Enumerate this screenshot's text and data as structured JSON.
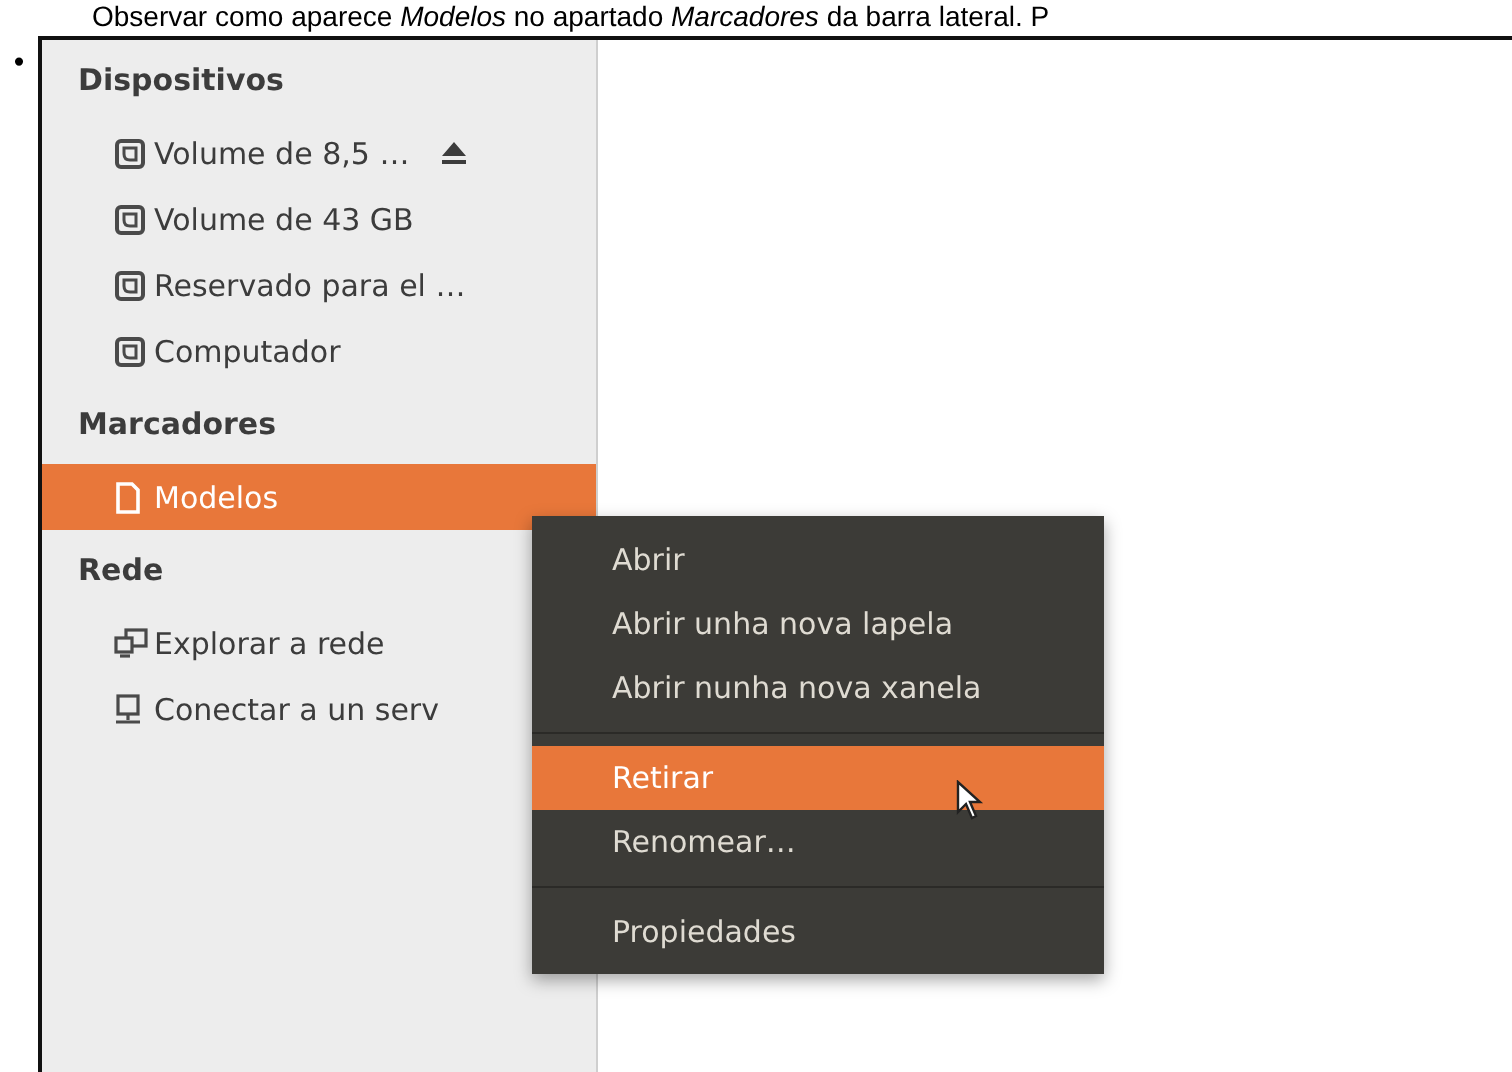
{
  "caption": "Observar como aparece *Modelos* no apartado *Marcadores* da barra lateral. P",
  "bullet": "•",
  "sidebar": {
    "sections": [
      {
        "title": "Dispositivos",
        "items": [
          {
            "label": "Volume de 8,5 …",
            "kind": "drive",
            "eject": true,
            "selected": false
          },
          {
            "label": "Volume de 43 GB",
            "kind": "drive",
            "eject": false,
            "selected": false
          },
          {
            "label": "Reservado para el …",
            "kind": "drive",
            "eject": false,
            "selected": false
          },
          {
            "label": "Computador",
            "kind": "drive",
            "eject": false,
            "selected": false
          }
        ]
      },
      {
        "title": "Marcadores",
        "items": [
          {
            "label": "Modelos",
            "kind": "document",
            "eject": false,
            "selected": true
          }
        ]
      },
      {
        "title": "Rede",
        "items": [
          {
            "label": "Explorar a rede",
            "kind": "network",
            "eject": false,
            "selected": false
          },
          {
            "label": "Conectar a un serv",
            "kind": "server",
            "eject": false,
            "selected": false
          }
        ]
      }
    ]
  },
  "context_menu": {
    "items": [
      {
        "kind": "item",
        "label": "Abrir",
        "selected": false
      },
      {
        "kind": "item",
        "label": "Abrir unha nova lapela",
        "selected": false
      },
      {
        "kind": "item",
        "label": "Abrir nunha nova xanela",
        "selected": false
      },
      {
        "kind": "separator"
      },
      {
        "kind": "item",
        "label": "Retirar",
        "selected": true
      },
      {
        "kind": "item",
        "label": "Renomear…",
        "selected": false
      },
      {
        "kind": "separator"
      },
      {
        "kind": "item",
        "label": "Propiedades",
        "selected": false
      }
    ]
  }
}
